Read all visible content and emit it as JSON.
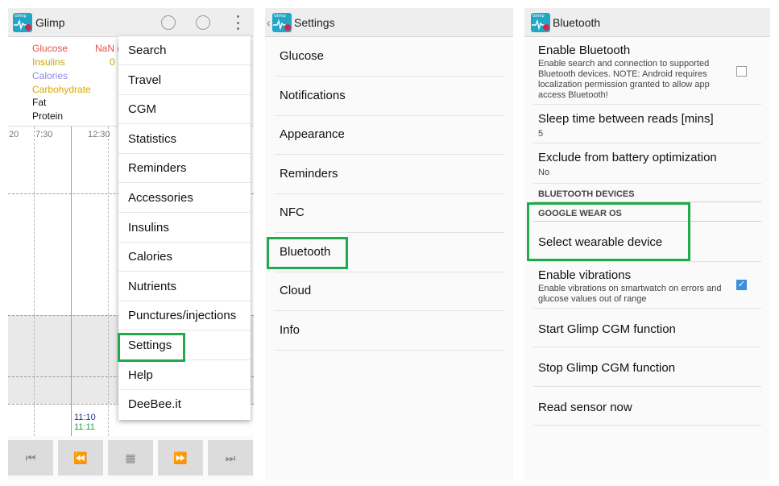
{
  "panel1": {
    "app_title": "Glimp",
    "icon_caption": "Glimp",
    "legend": {
      "glucose": "Glucose",
      "glucose_value": "NaN (",
      "insulins": "Insulins",
      "insulins_value": "0",
      "calories": "Calories",
      "carbohydrate": "Carbohydrate",
      "fat": "Fat",
      "protein": "Protein"
    },
    "chart": {
      "tick_left": "20",
      "tick_1": "7:30",
      "tick_2": "12:30",
      "time_a": "11:10",
      "time_b": "11:11"
    },
    "menu": [
      "Search",
      "Travel",
      "CGM",
      "Statistics",
      "Reminders",
      "Accessories",
      "Insulins",
      "Calories",
      "Nutrients",
      "Punctures/injections",
      "Settings",
      "Help",
      "DeeBee.it"
    ],
    "nav_icons": [
      "first-icon",
      "rewind-icon",
      "calendar-icon",
      "fast-forward-icon",
      "last-icon"
    ]
  },
  "panel2": {
    "title": "Settings",
    "items": [
      "Glucose",
      "Notifications",
      "Appearance",
      "Reminders",
      "NFC",
      "Bluetooth",
      "Cloud",
      "Info"
    ]
  },
  "panel3": {
    "title": "Bluetooth",
    "enable_bluetooth_title": "Enable Bluetooth",
    "enable_bluetooth_summary": "Enable search and connection to supported Bluetooth devices. NOTE: Android requires localization permission granted to allow app access Bluetooth!",
    "enable_bluetooth_checked": false,
    "sleep_title": "Sleep time between reads [mins]",
    "sleep_value": "5",
    "exclude_title": "Exclude from battery optimization",
    "exclude_value": "No",
    "cat_bt_devices": "BLUETOOTH DEVICES",
    "cat_wear_os": "GOOGLE WEAR OS",
    "select_wearable": "Select wearable device",
    "enable_vibrations_title": "Enable vibrations",
    "enable_vibrations_summary": "Enable vibrations on smartwatch on errors and glucose values out of range",
    "enable_vibrations_checked": true,
    "start_cgm": "Start Glimp CGM function",
    "stop_cgm": "Stop Glimp CGM function",
    "read_sensor": "Read sensor now"
  },
  "colors": {
    "glucose": "#e0534f",
    "insulins": "#c8a800",
    "calories": "#8d8ae8",
    "carbohydrate": "#d8a800",
    "highlight": "#1faa4b",
    "app_icon": "#20a7c7"
  }
}
